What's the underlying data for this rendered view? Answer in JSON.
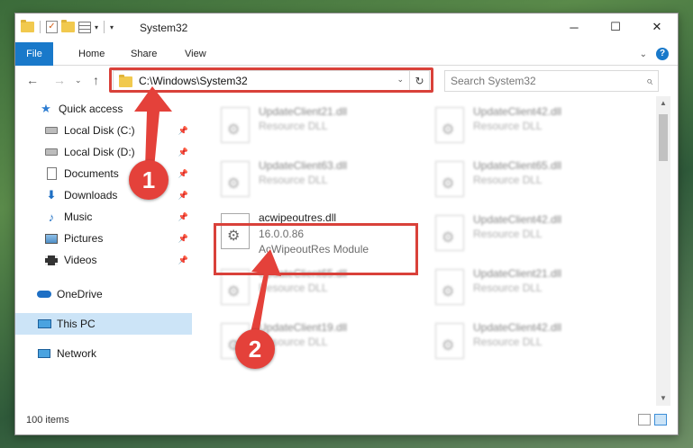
{
  "window": {
    "title": "System32",
    "controls": {
      "minimize": "─",
      "maximize": "☐",
      "close": "✕"
    }
  },
  "ribbon": {
    "tabs": [
      "File",
      "Home",
      "Share",
      "View"
    ],
    "collapse": "⌄",
    "help": "?"
  },
  "navigation": {
    "back": "←",
    "forward": "→",
    "recent": "⌄",
    "up": "↑",
    "address": "C:\\Windows\\System32",
    "address_dropdown": "⌄",
    "refresh": "↻",
    "search_placeholder": "Search System32",
    "search_icon": "⌕"
  },
  "sidebar": {
    "pin": "📌",
    "items": [
      {
        "label": "Quick access",
        "icon": "star-icon"
      },
      {
        "label": "Local Disk (C:)",
        "icon": "drive-icon",
        "pinned": true
      },
      {
        "label": "Local Disk (D:)",
        "icon": "drive-icon",
        "pinned": true
      },
      {
        "label": "Documents",
        "icon": "document-icon",
        "pinned": true
      },
      {
        "label": "Downloads",
        "icon": "download-icon",
        "pinned": true
      },
      {
        "label": "Music",
        "icon": "music-icon",
        "pinned": true
      },
      {
        "label": "Pictures",
        "icon": "pictures-icon",
        "pinned": true
      },
      {
        "label": "Videos",
        "icon": "videos-icon",
        "pinned": true
      },
      {
        "label": "OneDrive",
        "icon": "onedrive-icon"
      },
      {
        "label": "This PC",
        "icon": "computer-icon",
        "selected": true
      },
      {
        "label": "Network",
        "icon": "network-icon"
      }
    ]
  },
  "files": [
    {
      "name": "UpdateClient21.dll",
      "line1": "Resource DLL",
      "line2": ""
    },
    {
      "name": "UpdateClient42.dll",
      "line1": "Resource DLL",
      "line2": ""
    },
    {
      "name": "UpdateClient63.dll",
      "line1": "Resource DLL",
      "line2": ""
    },
    {
      "name": "UpdateClient65.dll",
      "line1": "Resource DLL",
      "line2": ""
    },
    {
      "name": "acwipeoutres.dll",
      "line1": "16.0.0.86",
      "line2": "AcWipeoutRes Module",
      "focused": true
    },
    {
      "name": "UpdateClient42.dll",
      "line1": "Resource DLL",
      "line2": ""
    },
    {
      "name": "UpdateClient65.dll",
      "line1": "Resource DLL",
      "line2": ""
    },
    {
      "name": "UpdateClient21.dll",
      "line1": "Resource DLL",
      "line2": ""
    },
    {
      "name": "UpdateClient19.dll",
      "line1": "Resource DLL",
      "line2": ""
    },
    {
      "name": "UpdateClient42.dll",
      "line1": "Resource DLL",
      "line2": ""
    }
  ],
  "status": {
    "item_count": "100 items"
  },
  "callouts": [
    "1",
    "2"
  ],
  "colors": {
    "accent": "#1979ca",
    "highlight": "#d9413a",
    "selection": "#cce4f7"
  }
}
